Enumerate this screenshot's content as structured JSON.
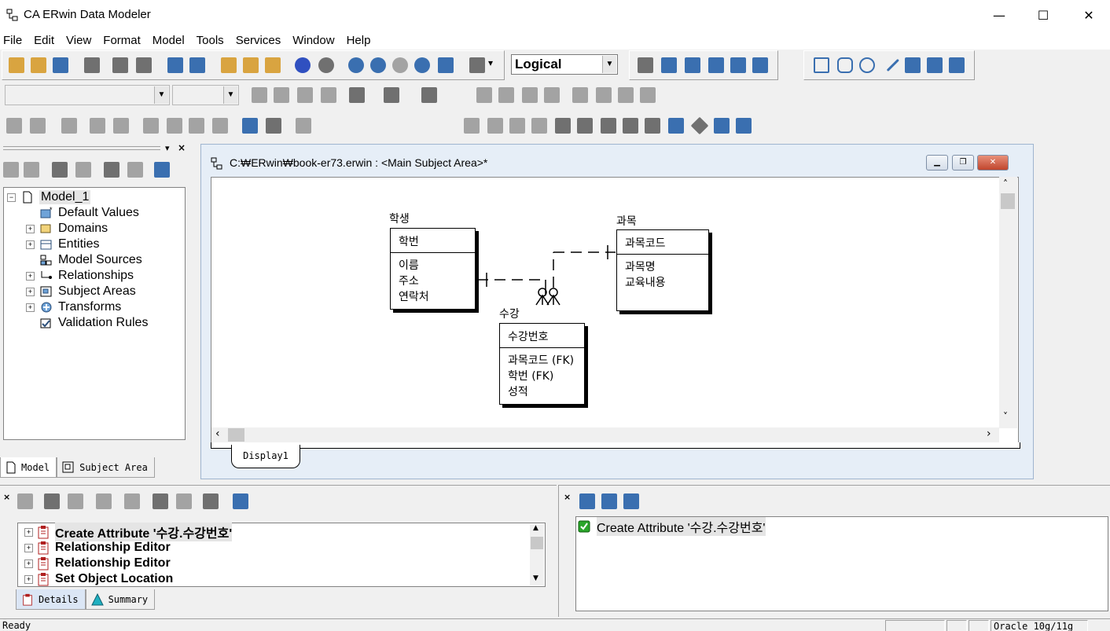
{
  "window": {
    "title": "CA ERwin Data Modeler",
    "minimize": "—",
    "maximize": "☐",
    "close": "✕"
  },
  "menu": [
    "File",
    "Edit",
    "View",
    "Format",
    "Model",
    "Tools",
    "Services",
    "Window",
    "Help"
  ],
  "toolbar": {
    "view_mode": "Logical"
  },
  "explorer": {
    "root": "Model_1",
    "items": [
      {
        "label": "Default Values",
        "expandable": false
      },
      {
        "label": "Domains",
        "expandable": true
      },
      {
        "label": "Entities",
        "expandable": true
      },
      {
        "label": "Model Sources",
        "expandable": false
      },
      {
        "label": "Relationships",
        "expandable": true
      },
      {
        "label": "Subject Areas",
        "expandable": true
      },
      {
        "label": "Transforms",
        "expandable": true
      },
      {
        "label": "Validation Rules",
        "expandable": false
      }
    ],
    "tabs": [
      "Model",
      "Subject Area"
    ]
  },
  "diagram": {
    "title": "C:₩ERwin₩book-er73.erwin : <Main Subject Area>*",
    "tab": "Display1",
    "entities": [
      {
        "name": "학생",
        "key": "학번",
        "attributes": [
          "이름",
          "주소",
          "연락처"
        ]
      },
      {
        "name": "과목",
        "key": "과목코드",
        "attributes": [
          "과목명",
          "교육내용"
        ]
      },
      {
        "name": "수강",
        "key": "수강번호",
        "attributes": [
          "과목코드 (FK)",
          "학번 (FK)",
          "성적"
        ]
      }
    ]
  },
  "action_log": {
    "items": [
      {
        "label": "Create Attribute '수강.수강번호'"
      },
      {
        "label": "Relationship Editor"
      },
      {
        "label": "Relationship Editor"
      },
      {
        "label": "Set Object Location"
      }
    ],
    "tabs": [
      "Details",
      "Summary"
    ]
  },
  "details": {
    "item": "Create Attribute '수강.수강번호'"
  },
  "status": {
    "text": "Ready",
    "target": "Oracle 10g/11g"
  }
}
